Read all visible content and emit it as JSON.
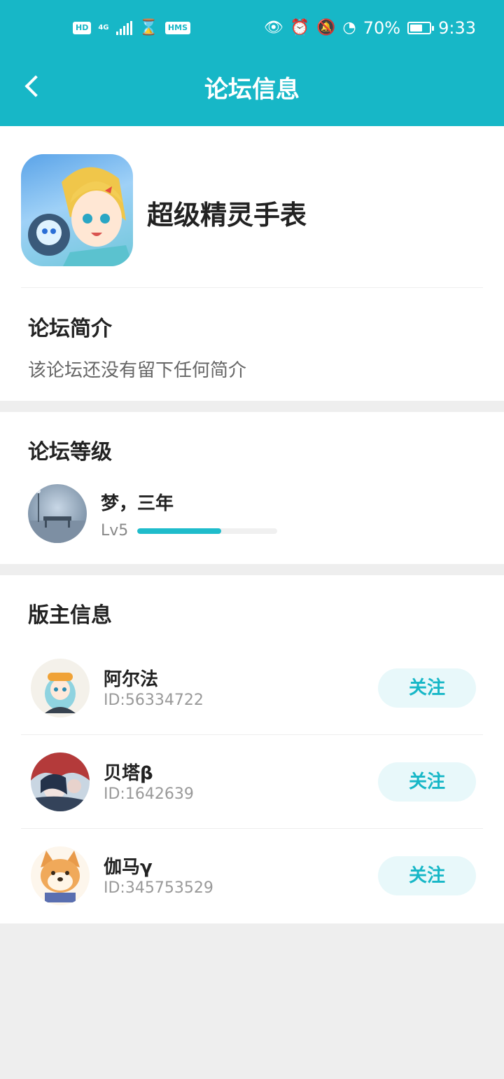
{
  "status_bar": {
    "left_badges": [
      "HD",
      "4G",
      "HMS"
    ],
    "battery_percent": "70%",
    "battery_level": 0.7,
    "time": "9:33"
  },
  "header": {
    "title": "论坛信息",
    "back_icon": "chevron-left-icon"
  },
  "forum": {
    "name": "超级精灵手表",
    "intro_title": "论坛简介",
    "intro_text": "该论坛还没有留下任何简介"
  },
  "level": {
    "section_title": "论坛等级",
    "user_name": "梦，三年",
    "level_label": "Lv5",
    "progress_fraction": 0.6
  },
  "moderators": {
    "section_title": "版主信息",
    "items": [
      {
        "name": "阿尔法",
        "id_text": "ID:56334722",
        "follow_label": "关注"
      },
      {
        "name": "贝塔β",
        "id_text": "ID:1642639",
        "follow_label": "关注"
      },
      {
        "name": "伽马γ",
        "id_text": "ID:345753529",
        "follow_label": "关注"
      }
    ]
  },
  "colors": {
    "brand": "#17b7c7",
    "progress": "#1fbccb",
    "follow_bg": "#e8f8fa"
  }
}
